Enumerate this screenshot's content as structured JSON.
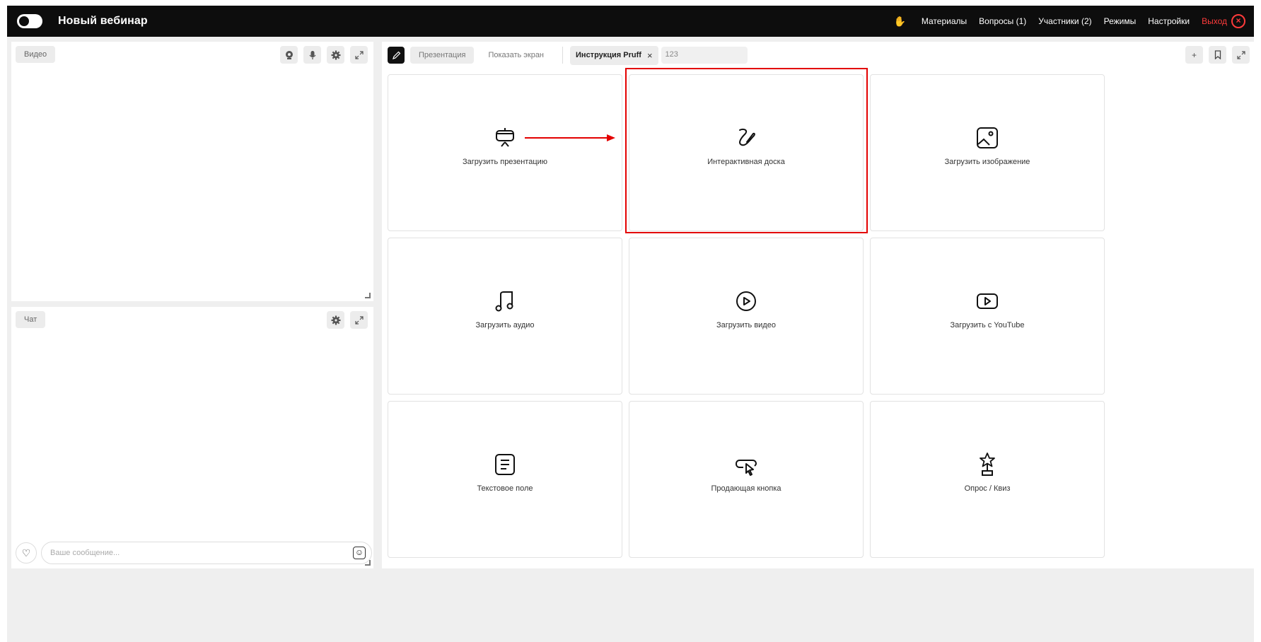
{
  "header": {
    "title": "Новый вебинар",
    "nav": [
      "Материалы",
      "Вопросы (1)",
      "Участники (2)",
      "Режимы",
      "Настройки"
    ],
    "exit_label": "Выход",
    "hand_icon": "✋",
    "exit_icon": "×"
  },
  "video_panel": {
    "label": "Видео",
    "tools": [
      "webcam-icon",
      "microphone-icon",
      "gear-icon",
      "expand-icon"
    ]
  },
  "chat_panel": {
    "label": "Чат",
    "tools": [
      "gear-icon",
      "expand-icon"
    ],
    "input_placeholder": "Ваше сообщение...",
    "heart_icon": "♡",
    "smile_icon": "☺"
  },
  "toolbar": {
    "tabs": [
      "Презентация",
      "Показать экран"
    ],
    "instruction_label": "Инструкция Pruff",
    "close_glyph": "×",
    "name_value": "123",
    "right_tools": [
      "+",
      "bookmark-icon",
      "expand-icon"
    ]
  },
  "cards": [
    {
      "label": "Загрузить презентацию",
      "icon": "presentation-icon"
    },
    {
      "label": "Интерактивная доска",
      "icon": "whiteboard-icon"
    },
    {
      "label": "Загрузить изображение",
      "icon": "image-icon"
    },
    {
      "label": "Загрузить аудио",
      "icon": "music-icon"
    },
    {
      "label": "Загрузить видео",
      "icon": "play-circle-icon"
    },
    {
      "label": "Загрузить с YouTube",
      "icon": "youtube-icon"
    },
    {
      "label": "Текстовое поле",
      "icon": "text-field-icon"
    },
    {
      "label": "Продающая кнопка",
      "icon": "cursor-button-icon"
    },
    {
      "label": "Опрос / Квиз",
      "icon": "trophy-icon"
    }
  ],
  "colors": {
    "topbar": "#0d0d0d",
    "exit": "#ff3b3b",
    "highlight": "#e30000"
  }
}
